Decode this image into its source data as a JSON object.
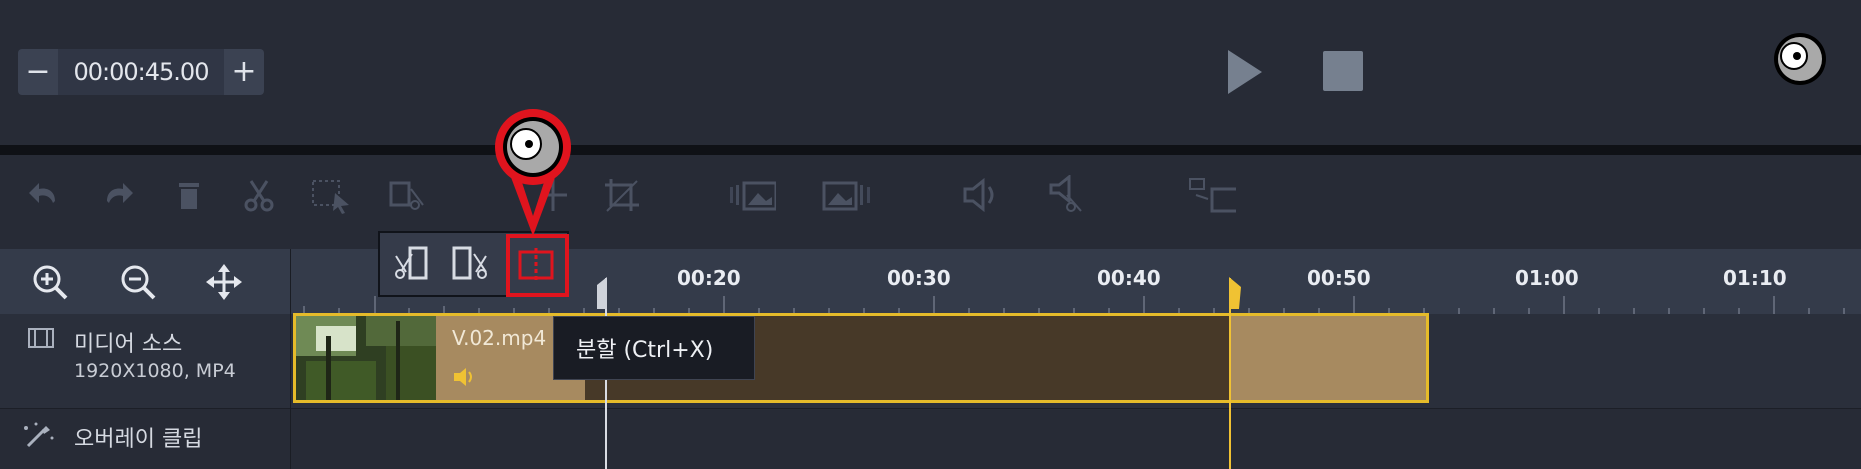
{
  "transport": {
    "minus_label": "−",
    "plus_label": "+",
    "duration_value": "00:00:45.00"
  },
  "ruler": {
    "ticks": [
      "00:20",
      "00:30",
      "00:40",
      "00:50",
      "01:00",
      "01:10"
    ]
  },
  "tracks": {
    "media": {
      "label": "미디어 소스",
      "sub": "1920X1080, MP4"
    },
    "overlay": {
      "label": "오버레이 클립"
    }
  },
  "clip": {
    "name": "V.02.mp4"
  },
  "tooltip": {
    "text": "분할 (Ctrl+X)"
  },
  "colors": {
    "accent_yellow": "#e5bb2a",
    "highlight_red": "#e0141e"
  }
}
